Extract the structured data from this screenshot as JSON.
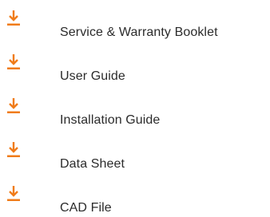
{
  "accent_color": "#f07c1a",
  "downloads": {
    "icon": "download-icon",
    "items": [
      {
        "label": "Service & Warranty Booklet"
      },
      {
        "label": "User Guide"
      },
      {
        "label": "Installation Guide"
      },
      {
        "label": "Data Sheet"
      },
      {
        "label": "CAD File"
      }
    ]
  }
}
